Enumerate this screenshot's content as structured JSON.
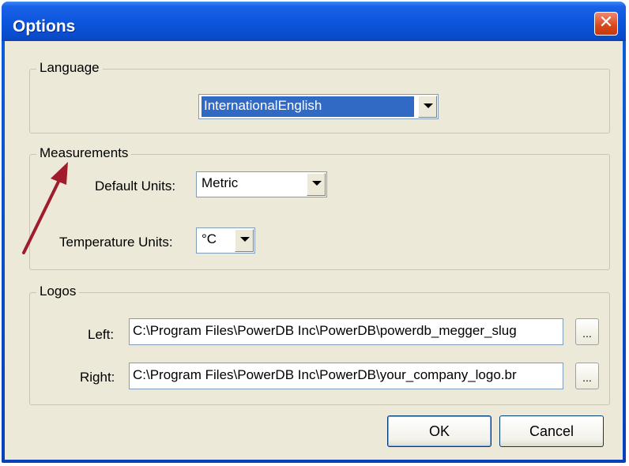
{
  "window": {
    "title": "Options",
    "close_label": "✕"
  },
  "language": {
    "group_label": "Language",
    "selected": "InternationalEnglish"
  },
  "measurements": {
    "group_label": "Measurements",
    "default_units_label": "Default Units:",
    "default_units_value": "Metric",
    "temperature_units_label": "Temperature Units:",
    "temperature_units_value": "°C"
  },
  "logos": {
    "group_label": "Logos",
    "left_label": "Left:",
    "left_value": "C:\\Program Files\\PowerDB Inc\\PowerDB\\powerdb_megger_slug",
    "right_label": "Right:",
    "right_value": "C:\\Program Files\\PowerDB Inc\\PowerDB\\your_company_logo.br",
    "browse_label": "..."
  },
  "buttons": {
    "ok": "OK",
    "cancel": "Cancel"
  },
  "colors": {
    "titlebar": "#0a4ccc",
    "annotation_arrow": "#a01c2c",
    "selection": "#316ac5"
  }
}
